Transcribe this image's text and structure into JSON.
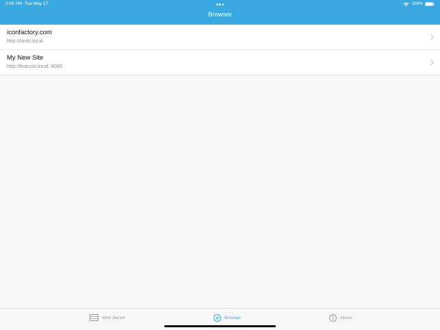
{
  "status_bar": {
    "time": "2:05 PM",
    "date": "Tue May 17",
    "battery": "100%",
    "wifi_icon": "wifi-icon",
    "battery_icon": "battery-icon"
  },
  "nav": {
    "title": "Browser"
  },
  "sites": [
    {
      "title": "iconfactory.com",
      "url": "http://tasto.local."
    },
    {
      "title": "My New Site",
      "url": "http://braccio.local.:8080"
    }
  ],
  "tab_bar": {
    "tabs": [
      {
        "label": "Web Server",
        "icon": "server-icon",
        "active": false
      },
      {
        "label": "Browser",
        "icon": "compass-icon",
        "active": true
      },
      {
        "label": "About",
        "icon": "info-icon",
        "active": false
      }
    ]
  },
  "colors": {
    "accent": "#3aa8e0",
    "background": "#f7f7f7",
    "row_background": "#ffffff",
    "secondary_text": "#8b8b8b"
  }
}
